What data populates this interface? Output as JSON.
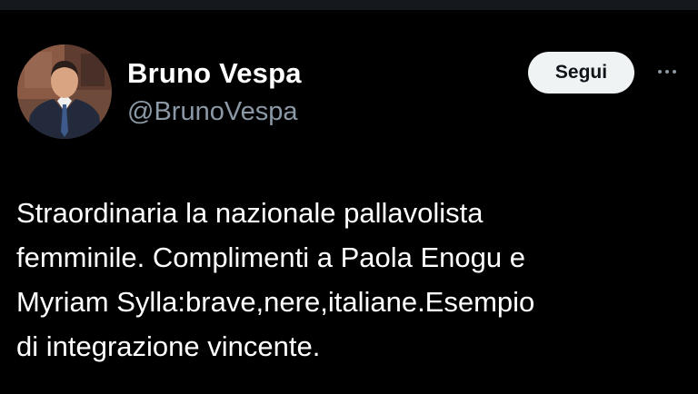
{
  "author": {
    "name": "Bruno Vespa",
    "handle": "@BrunoVespa"
  },
  "actions": {
    "follow_label": "Segui",
    "more_icon": "more-horizontal-icon"
  },
  "tweet": {
    "lines": [
      "Straordinaria la nazionale pallavolista",
      "femminile. Complimenti a Paola Enogu e",
      "Myriam Sylla:brave,nere,italiane.Esempio",
      "di integrazione vincente."
    ]
  },
  "colors": {
    "background": "#000000",
    "text_primary": "#ffffff",
    "text_secondary": "#8b98a5",
    "button_bg": "#eff3f4",
    "button_text": "#0f1419"
  }
}
